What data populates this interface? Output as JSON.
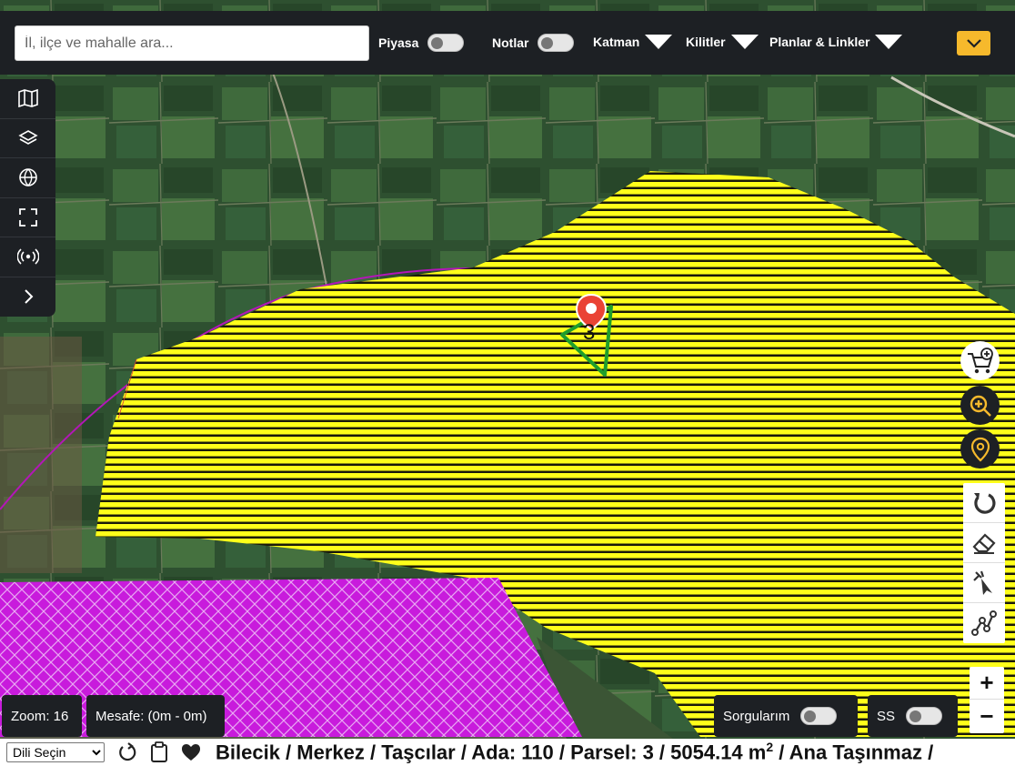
{
  "search": {
    "placeholder": "İl, ilçe ve mahalle ara..."
  },
  "topbar": {
    "piyasa_label": "Piyasa",
    "notlar_label": "Notlar",
    "katman_label": "Katman",
    "kilitler_label": "Kilitler",
    "planlar_label": "Planlar & Linkler",
    "menu_icon": "chevron-down-icon"
  },
  "left_toolbar": {
    "icons": [
      "map-icon",
      "layers-icon",
      "globe-icon",
      "fullscreen-icon",
      "broadcast-icon",
      "chevron-right-icon"
    ]
  },
  "map": {
    "parcel_marker_number": "3",
    "colors": {
      "zone_yellow": "#ffff1a",
      "zone_purple": "#c81bdc",
      "parcel_outline": "#1f9e2c",
      "marker_red": "#ea4335"
    }
  },
  "right_tools": {
    "icons": [
      "cart-plus-icon",
      "zoom-search-icon",
      "location-pin-icon",
      "undo-icon",
      "eraser-icon",
      "pointer-icon",
      "polyline-icon"
    ],
    "zoom_in": "+",
    "zoom_out": "−"
  },
  "bottom": {
    "zoom_text": "Zoom: 16",
    "distance_text": "Mesafe: (0m - 0m)",
    "sorgu_label": "Sorgularım",
    "ss_label": "SS"
  },
  "statusbar": {
    "language_select": "Dili Seçin",
    "breadcrumb_main": "Bilecik / Merkez / Taşcılar / Ada: 110 / Parsel: 3 / 5054.14 m",
    "breadcrumb_sup": "2",
    "breadcrumb_tail": " / Ana Taşınmaz /"
  }
}
